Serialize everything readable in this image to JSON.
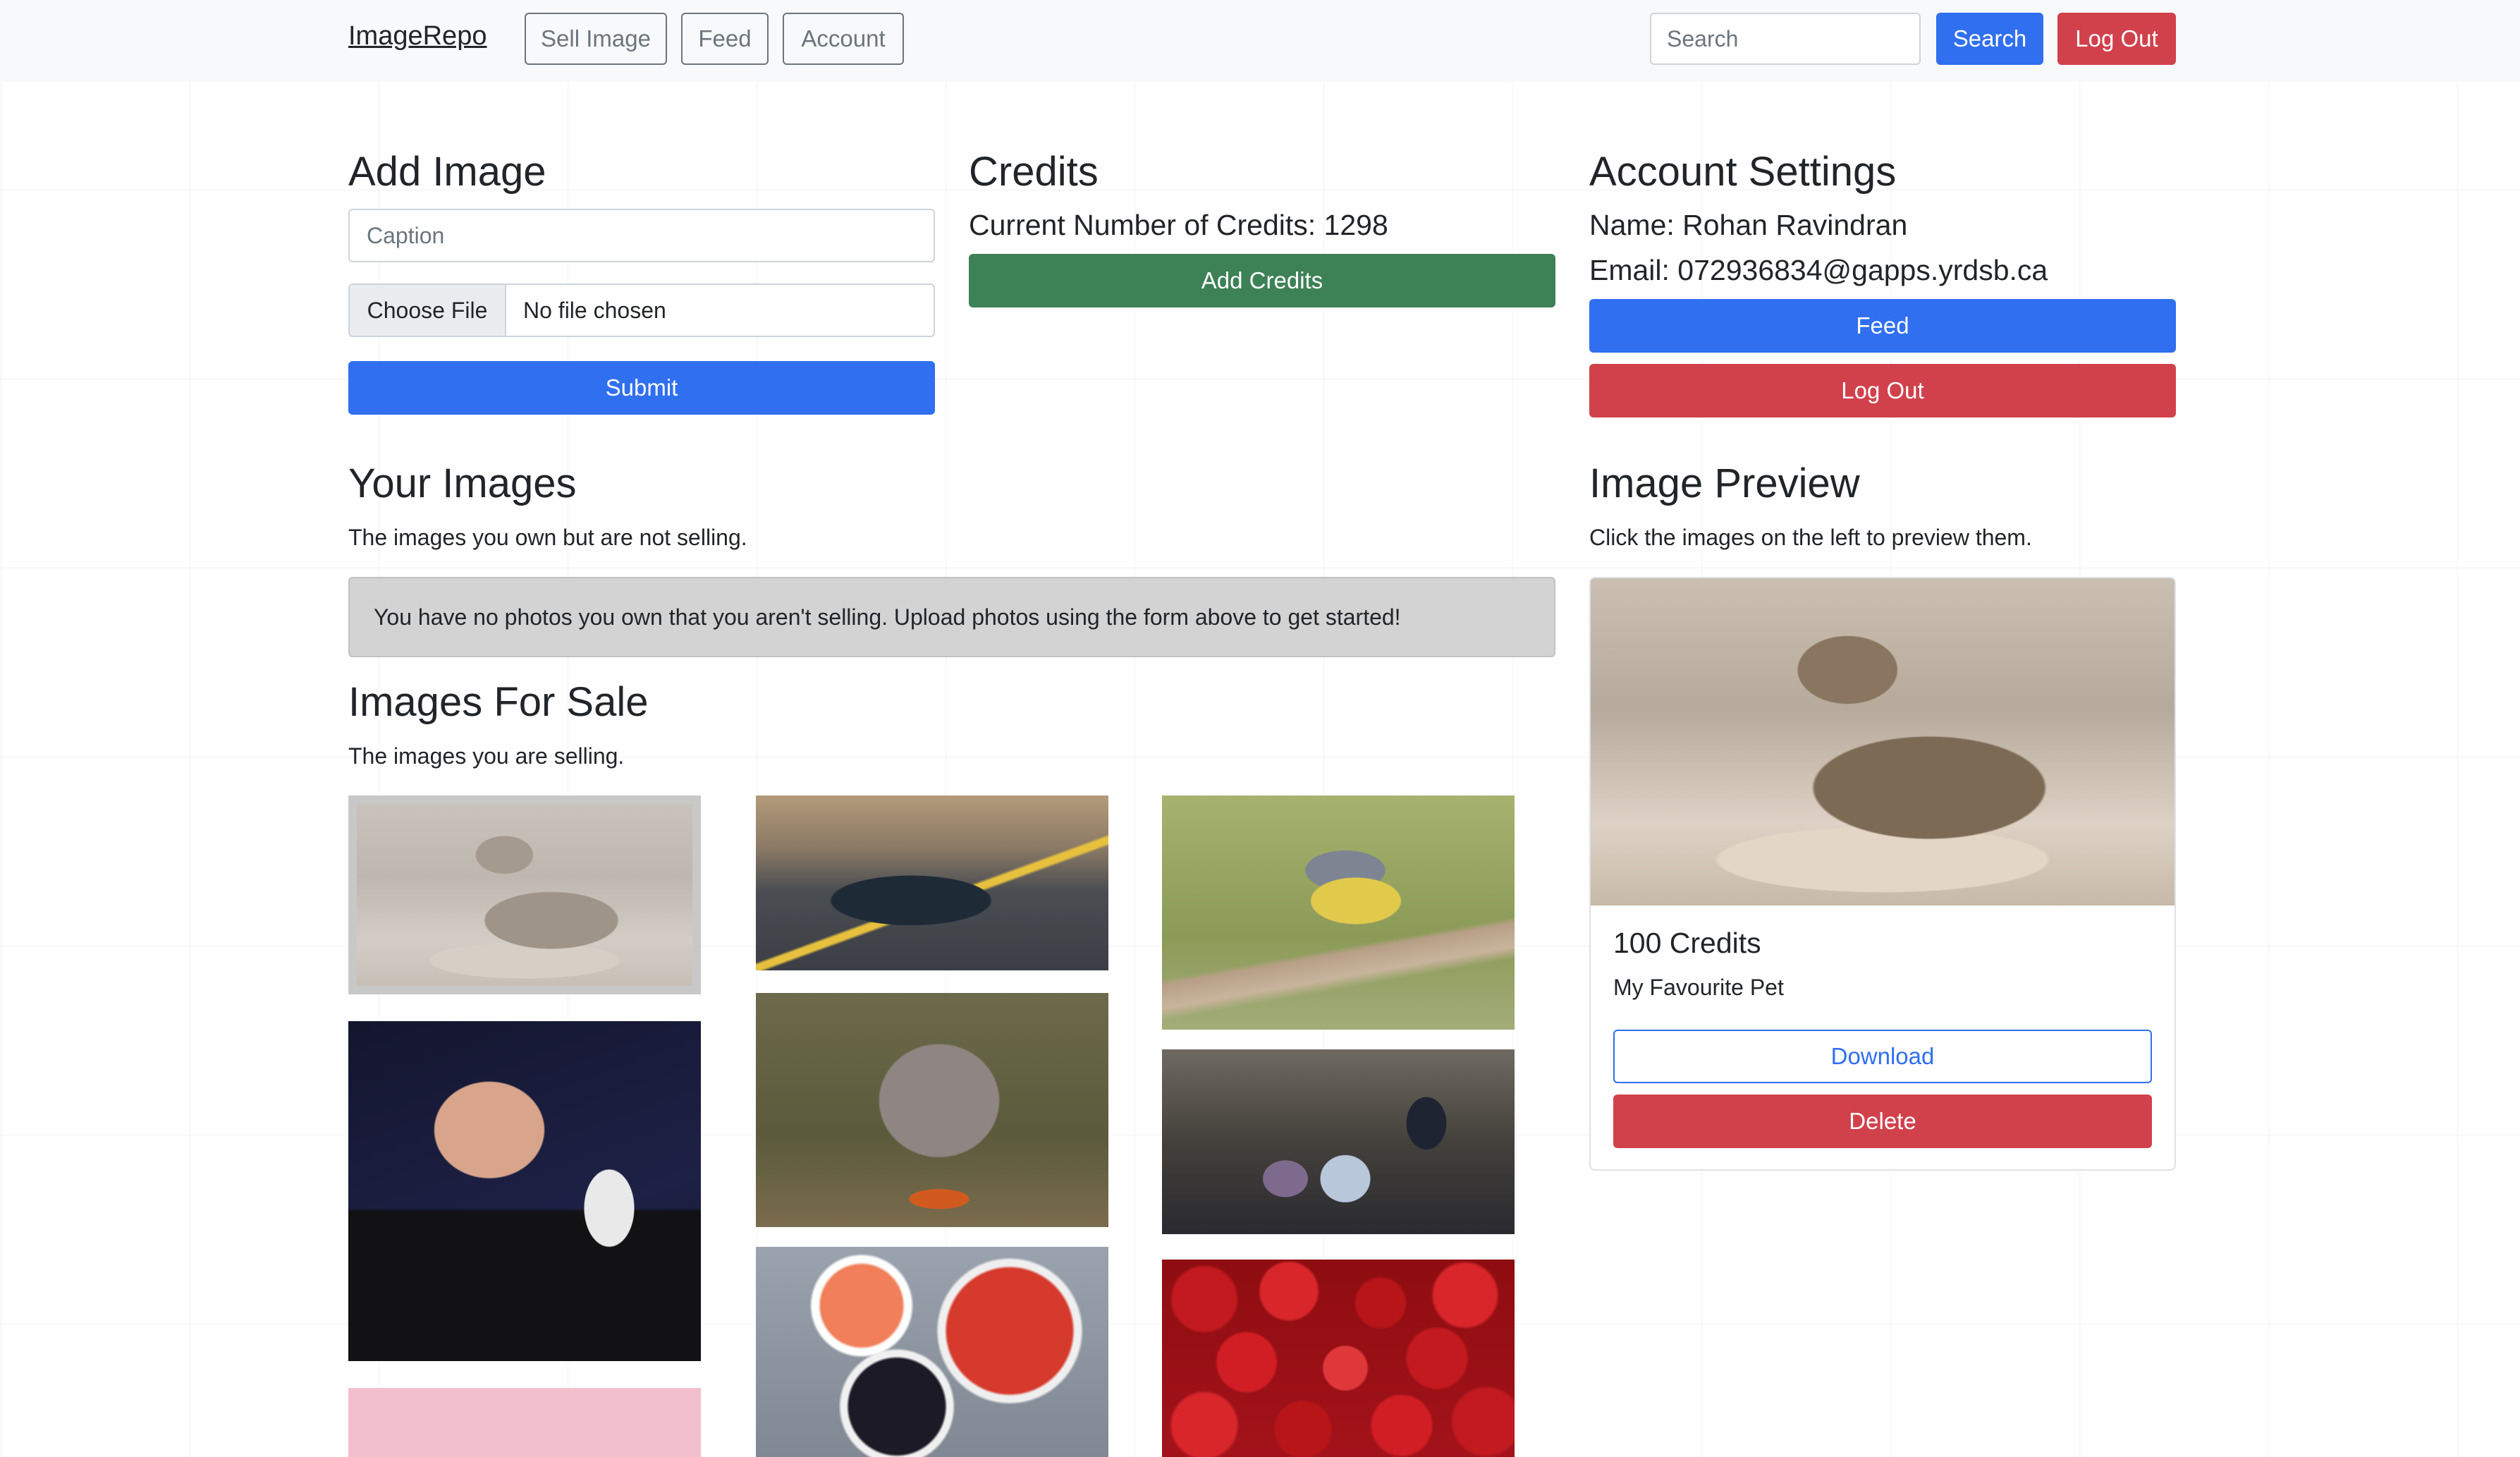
{
  "navbar": {
    "brand": "ImageRepo",
    "links": [
      "Sell Image",
      "Feed",
      "Account"
    ],
    "search_placeholder": "Search",
    "search_button": "Search",
    "logout_button": "Log Out"
  },
  "add_image": {
    "title": "Add Image",
    "caption_placeholder": "Caption",
    "choose_file_label": "Choose File",
    "file_status": "No file chosen",
    "submit_label": "Submit"
  },
  "credits": {
    "title": "Credits",
    "current_text": "Current Number of Credits: 1298",
    "add_credits_label": "Add Credits"
  },
  "account_settings": {
    "title": "Account Settings",
    "name_text": "Name: Rohan Ravindran",
    "email_text": "Email: 072936834@gapps.yrdsb.ca",
    "feed_label": "Feed",
    "logout_label": "Log Out"
  },
  "your_images": {
    "title": "Your Images",
    "subtitle": "The images you own but are not selling.",
    "empty_message": "You have no photos you own that you aren't selling. Upload photos using the form above to get started!"
  },
  "images_for_sale": {
    "title": "Images For Sale",
    "subtitle": "The images you are selling.",
    "images": [
      {
        "name": "cat",
        "selected": true
      },
      {
        "name": "steve-jobs",
        "selected": false
      },
      {
        "name": "pink",
        "selected": false
      },
      {
        "name": "car",
        "selected": false
      },
      {
        "name": "dog",
        "selected": false
      },
      {
        "name": "fruit",
        "selected": false
      },
      {
        "name": "bird",
        "selected": false
      },
      {
        "name": "office",
        "selected": false
      },
      {
        "name": "strawberries",
        "selected": false
      }
    ]
  },
  "image_preview": {
    "title": "Image Preview",
    "subtitle": "Click the images on the left to preview them.",
    "price_text": "100 Credits",
    "caption_text": "My Favourite Pet",
    "download_label": "Download",
    "delete_label": "Delete"
  },
  "colors": {
    "primary": "#2f6ff0",
    "danger": "#d1414c",
    "success": "#3d8157",
    "navbar_bg": "#f8f9fa"
  }
}
